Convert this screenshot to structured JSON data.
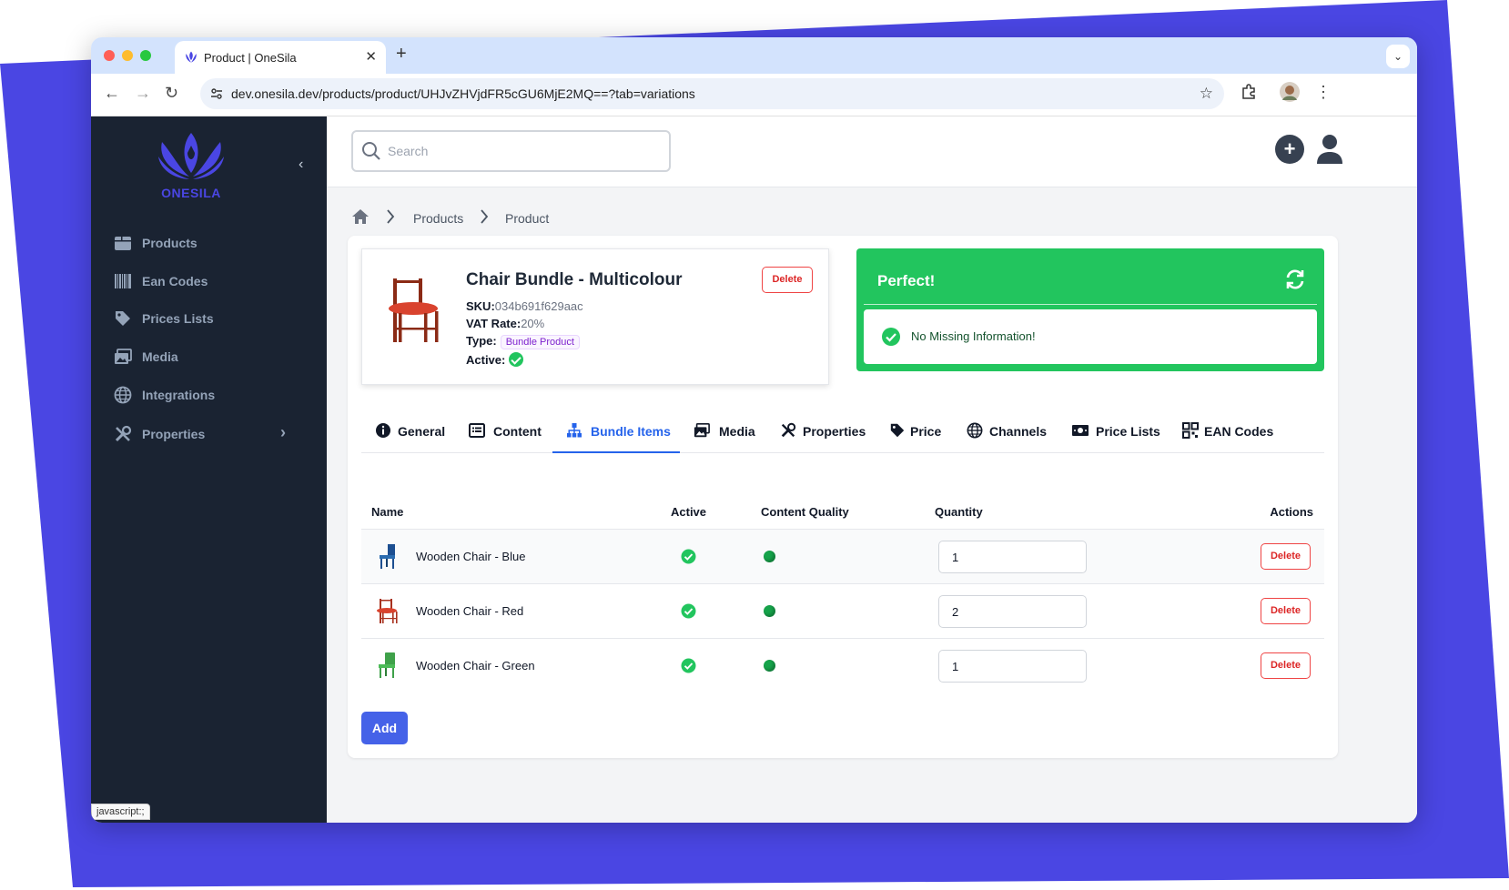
{
  "colors": {
    "brand": "#4a46e3",
    "sidebar_bg": "#1a2332",
    "success": "#22c55e",
    "danger": "#dc2626",
    "primary": "#4562e8"
  },
  "browser": {
    "tab_title": "Product | OneSila",
    "url": "dev.onesila.dev/products/product/UHJvZHVjdFR5cGU6MjE2MQ==?tab=variations",
    "status_url": "javascript:;"
  },
  "sidebar": {
    "logo_text": "ONESILA",
    "items": [
      {
        "label": "Products",
        "icon": "box-icon"
      },
      {
        "label": "Ean Codes",
        "icon": "barcode-icon"
      },
      {
        "label": "Prices Lists",
        "icon": "tag-icon"
      },
      {
        "label": "Media",
        "icon": "images-icon"
      },
      {
        "label": "Integrations",
        "icon": "globe-icon"
      },
      {
        "label": "Properties",
        "icon": "tools-icon"
      }
    ]
  },
  "topbar": {
    "search_placeholder": "Search"
  },
  "breadcrumb": {
    "items": [
      "Products",
      "Product"
    ]
  },
  "product": {
    "title": "Chair Bundle - Multicolour",
    "delete_label": "Delete",
    "sku_label": "SKU:",
    "sku": "034b691f629aac",
    "vat_label": "VAT Rate:",
    "vat": "20%",
    "type_label": "Type:",
    "type": "Bundle Product",
    "active_label": "Active:",
    "active": true
  },
  "health": {
    "title": "Perfect!",
    "message": "No Missing Information!"
  },
  "tabs": {
    "active": "Bundle Items",
    "items": [
      "General",
      "Content",
      "Bundle Items",
      "Media",
      "Properties",
      "Price",
      "Channels",
      "Price Lists",
      "EAN Codes"
    ]
  },
  "table": {
    "headers": {
      "name": "Name",
      "active": "Active",
      "quality": "Content Quality",
      "quantity": "Quantity",
      "actions": "Actions"
    },
    "rows": [
      {
        "name": "Wooden Chair - Blue",
        "active": true,
        "quality": "good",
        "quantity": "1",
        "action": "Delete",
        "chair_color": "#1d4f91"
      },
      {
        "name": "Wooden Chair - Red",
        "active": true,
        "quality": "good",
        "quantity": "2",
        "action": "Delete",
        "chair_color": "#a8321f"
      },
      {
        "name": "Wooden Chair - Green",
        "active": true,
        "quality": "good",
        "quantity": "1",
        "action": "Delete",
        "chair_color": "#3fa14a"
      }
    ],
    "add_label": "Add"
  }
}
